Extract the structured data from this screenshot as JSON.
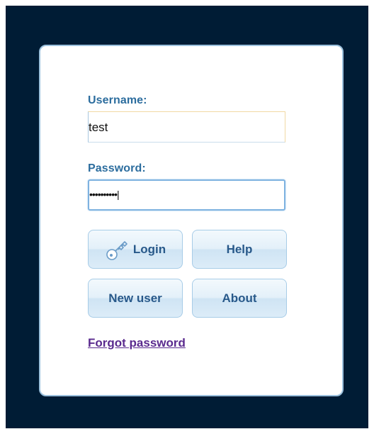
{
  "form": {
    "username_label": "Username:",
    "username_value": "test",
    "password_label": "Password:",
    "password_value": "••••••••••|"
  },
  "buttons": {
    "login": "Login",
    "help": "Help",
    "new_user": "New user",
    "about": "About"
  },
  "links": {
    "forgot_password": "Forgot password"
  },
  "icons": {
    "login_icon": "key-icon"
  },
  "colors": {
    "backdrop": "#001c35",
    "label": "#2c6d9e",
    "button_text": "#28598a",
    "link": "#5a2a8e"
  }
}
